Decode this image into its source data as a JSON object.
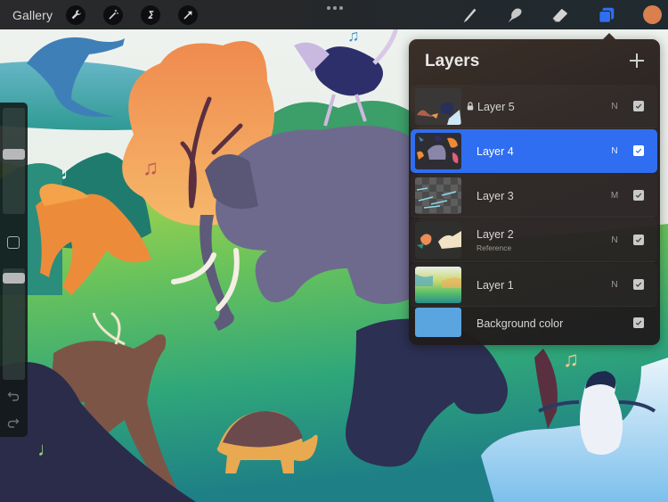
{
  "toolbar": {
    "gallery_label": "Gallery",
    "left_tools": [
      {
        "name": "actions",
        "icon": "wrench-icon"
      },
      {
        "name": "adjustments",
        "icon": "magic-wand-icon"
      },
      {
        "name": "selection",
        "icon": "selection-s-icon"
      },
      {
        "name": "transform",
        "icon": "arrow-cursor-icon"
      }
    ],
    "more_icon": "more-dots-icon",
    "right_tools": [
      {
        "name": "brush",
        "icon": "brush-icon",
        "active": false
      },
      {
        "name": "smudge",
        "icon": "smudge-finger-icon",
        "active": false
      },
      {
        "name": "eraser",
        "icon": "eraser-icon",
        "active": false
      },
      {
        "name": "layers",
        "icon": "layers-icon",
        "active": true
      }
    ],
    "current_color": "#d9804e",
    "accent_color": "#2f6ef0"
  },
  "sidebar": {
    "brush_size_fraction": 0.43,
    "opacity_fraction": 0.04,
    "modify_icon": "square-modify-icon",
    "undo_icon": "undo-icon",
    "redo_icon": "redo-icon"
  },
  "layers_panel": {
    "title": "Layers",
    "add_icon": "plus-icon",
    "layers": [
      {
        "name": "Layer 5",
        "blend": "N",
        "visible": true,
        "locked": true,
        "selected": false,
        "subtitle": ""
      },
      {
        "name": "Layer 4",
        "blend": "N",
        "visible": true,
        "locked": false,
        "selected": true,
        "subtitle": ""
      },
      {
        "name": "Layer 3",
        "blend": "M",
        "visible": true,
        "locked": false,
        "selected": false,
        "subtitle": ""
      },
      {
        "name": "Layer 2",
        "blend": "N",
        "visible": true,
        "locked": false,
        "selected": false,
        "subtitle": "Reference"
      },
      {
        "name": "Layer 1",
        "blend": "N",
        "visible": true,
        "locked": false,
        "selected": false,
        "subtitle": ""
      }
    ],
    "background": {
      "name": "Background color",
      "color": "#5aa5e0",
      "visible": true
    }
  },
  "canvas": {
    "description": "Illustration of jungle animals dancing: dolphin, ostrich, fox, elephant, deer, tortoise, gorilla, penguin with music notes"
  }
}
